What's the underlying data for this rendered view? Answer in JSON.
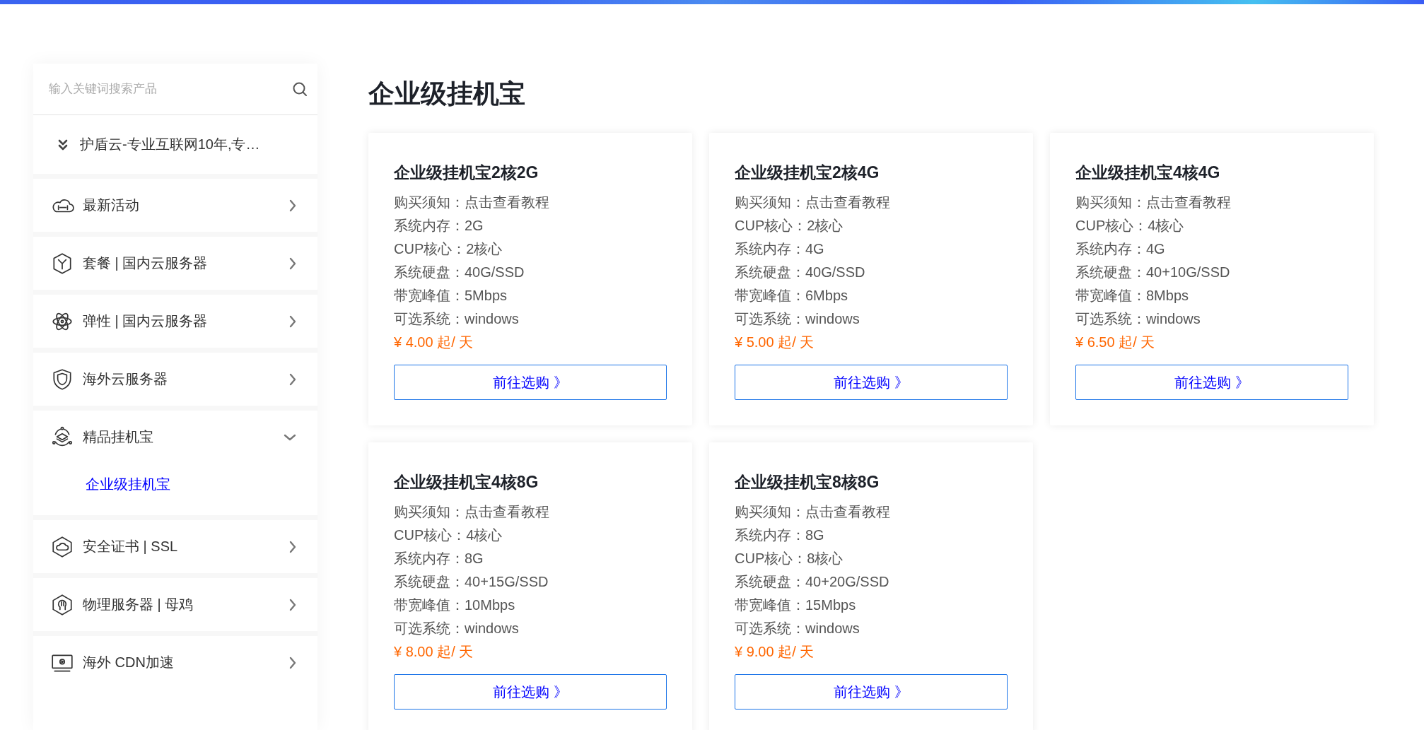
{
  "search": {
    "placeholder": "输入关键词搜索产品"
  },
  "notice": {
    "text": "护盾云-专业互联网10年,专…"
  },
  "categories": [
    {
      "label": "最新活动",
      "expanded": false
    },
    {
      "label": "套餐 | 国内云服务器",
      "expanded": false
    },
    {
      "label": "弹性 | 国内云服务器",
      "expanded": false
    },
    {
      "label": "海外云服务器",
      "expanded": false
    },
    {
      "label": "精品挂机宝",
      "expanded": true,
      "children": [
        {
          "label": "企业级挂机宝",
          "selected": true
        }
      ]
    },
    {
      "label": "安全证书 | SSL",
      "expanded": false
    },
    {
      "label": "物理服务器 | 母鸡",
      "expanded": false
    },
    {
      "label": "海外 CDN加速",
      "expanded": false
    }
  ],
  "page_title": "企业级挂机宝",
  "products": [
    {
      "name": "企业级挂机宝2核2G",
      "specs": [
        "购买须知：点击查看教程",
        "系统内存：2G",
        "CUP核心：2核心",
        "系统硬盘：40G/SSD",
        "带宽峰值：5Mbps",
        "可选系统：windows"
      ],
      "price": "¥ 4.00 起/ 天",
      "button": "前往选购 》"
    },
    {
      "name": "企业级挂机宝2核4G",
      "specs": [
        "购买须知：点击查看教程",
        "CUP核心：2核心",
        "系统内存：4G",
        "系统硬盘：40G/SSD",
        "带宽峰值：6Mbps",
        "可选系统：windows"
      ],
      "price": "¥ 5.00 起/ 天",
      "button": "前往选购 》"
    },
    {
      "name": "企业级挂机宝4核4G",
      "specs": [
        "购买须知：点击查看教程",
        "CUP核心：4核心",
        "系统内存：4G",
        "系统硬盘：40+10G/SSD",
        "带宽峰值：8Mbps",
        "可选系统：windows"
      ],
      "price": "¥ 6.50 起/ 天",
      "button": "前往选购 》"
    },
    {
      "name": "企业级挂机宝4核8G",
      "specs": [
        "购买须知：点击查看教程",
        "CUP核心：4核心",
        "系统内存：8G",
        "系统硬盘：40+15G/SSD",
        "带宽峰值：10Mbps",
        "可选系统：windows"
      ],
      "price": "¥ 8.00 起/ 天",
      "button": "前往选购 》"
    },
    {
      "name": "企业级挂机宝8核8G",
      "specs": [
        "购买须知：点击查看教程",
        "系统内存：8G",
        "CUP核心：8核心",
        "系统硬盘：40+20G/SSD",
        "带宽峰值：15Mbps",
        "可选系统：windows"
      ],
      "price": "¥ 9.00 起/ 天",
      "button": "前往选购 》"
    }
  ]
}
